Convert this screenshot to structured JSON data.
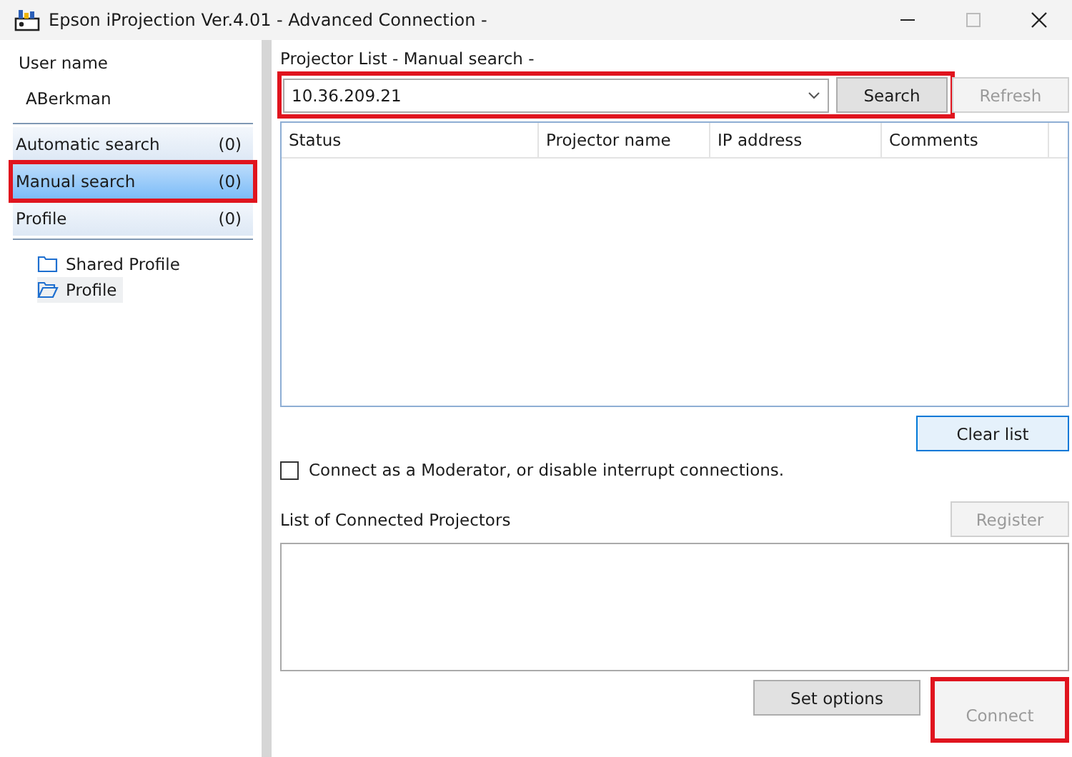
{
  "window": {
    "title": "Epson iProjection Ver.4.01 - Advanced Connection -"
  },
  "sidebar": {
    "user_label": "User name",
    "user_name": "ABerkman",
    "nav": [
      {
        "label": "Automatic search",
        "count": "(0)",
        "selected": false,
        "highlighted": false
      },
      {
        "label": "Manual search",
        "count": "(0)",
        "selected": true,
        "highlighted": true
      },
      {
        "label": "Profile",
        "count": "(0)",
        "selected": false,
        "highlighted": false
      }
    ],
    "tree": [
      {
        "label": "Shared Profile",
        "selected": false
      },
      {
        "label": "Profile",
        "selected": true
      }
    ]
  },
  "projector_list": {
    "title": "Projector List - Manual search -",
    "address": "10.36.209.21",
    "highlighted": true,
    "search_button": {
      "label": "Search",
      "disabled": false
    },
    "refresh_button": {
      "label": "Refresh",
      "disabled": true
    },
    "columns": [
      "Status",
      "Projector name",
      "IP address",
      "Comments"
    ],
    "clear_button": {
      "label": "Clear list",
      "disabled": false
    }
  },
  "moderator": {
    "label": "Connect as a Moderator, or disable interrupt connections.",
    "checked": false
  },
  "connected": {
    "title": "List of Connected Projectors",
    "register_button": {
      "label": "Register",
      "disabled": true
    },
    "options_button": {
      "label": "Set options",
      "disabled": false
    },
    "connect_button": {
      "label": "Connect",
      "disabled": true,
      "highlighted": true
    }
  }
}
